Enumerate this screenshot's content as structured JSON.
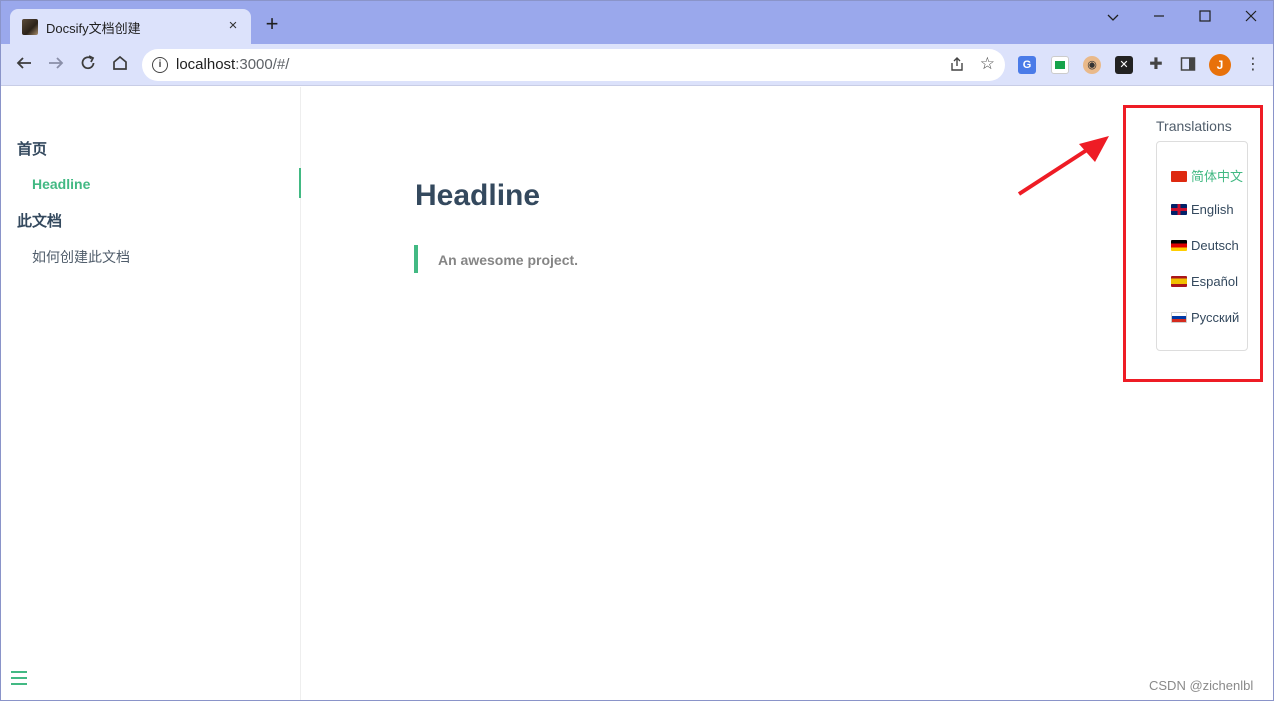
{
  "browser": {
    "tab_title": "Docsify文档创建",
    "tab_close": "×",
    "new_tab": "+",
    "url_host": "localhost",
    "url_rest": ":3000/#/",
    "avatar_letter": "J",
    "window_controls": [
      "chevron-down-icon",
      "minimize-icon",
      "maximize-icon",
      "close-icon"
    ]
  },
  "sidebar": {
    "groups": [
      {
        "label": "首页",
        "items": [
          {
            "label": "Headline",
            "active": true
          }
        ]
      },
      {
        "label": "此文档",
        "items": [
          {
            "label": "如何创建此文档",
            "active": false
          }
        ]
      }
    ]
  },
  "main": {
    "headline": "Headline",
    "blockquote": "An awesome project."
  },
  "translations": {
    "label": "Translations",
    "items": [
      {
        "label": "简体中文",
        "flag": "cn-flag-icon",
        "active": true
      },
      {
        "label": "English",
        "flag": "gb-flag-icon",
        "active": false
      },
      {
        "label": "Deutsch",
        "flag": "de-flag-icon",
        "active": false
      },
      {
        "label": "Español",
        "flag": "es-flag-icon",
        "active": false
      },
      {
        "label": "Русский",
        "flag": "ru-flag-icon",
        "active": false
      }
    ]
  },
  "colors": {
    "accent": "#42b983",
    "highlight": "#ee1c25",
    "tabstrip": "#9aa8ec",
    "toolbar": "#dce2fb"
  },
  "watermark": "CSDN @zichenlbl"
}
